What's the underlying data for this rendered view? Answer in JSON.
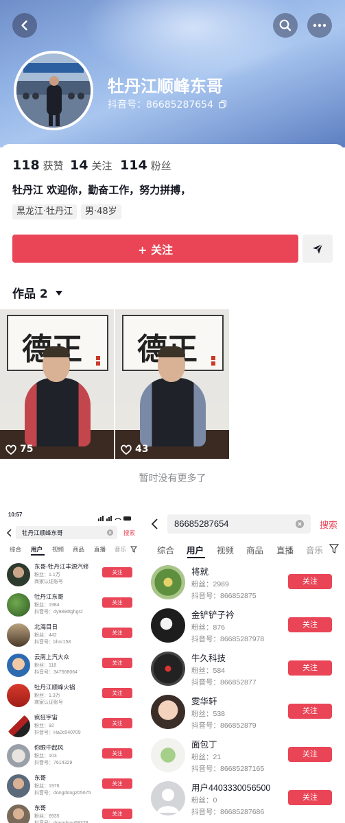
{
  "profile": {
    "name": "牡丹江顺峰东哥",
    "douyin_id": "抖音号：86685287654",
    "stats": [
      {
        "value": "118",
        "label": "获赞"
      },
      {
        "value": "14",
        "label": "关注"
      },
      {
        "value": "114",
        "label": "粉丝"
      }
    ],
    "bio": "牡丹江 欢迎你，勤奋工作，努力拼搏，",
    "tags": [
      "黑龙江·牡丹江",
      "男·48岁"
    ],
    "follow_label": "+ 关注",
    "works_label": "作品 2",
    "videos": [
      {
        "likes": "75",
        "calligraphy": "德正"
      },
      {
        "likes": "43",
        "calligraphy": "德正"
      }
    ],
    "no_more": "暂时没有更多了"
  },
  "left_search": {
    "status_time": "10:57",
    "query": "牡丹江顺峰东哥",
    "search_label": "搜索",
    "tabs": [
      "综合",
      "用户",
      "视频",
      "商品",
      "直播",
      "音乐"
    ],
    "active_tab": "用户",
    "follow_label": "关注",
    "results": [
      {
        "name": "东哥-牡丹江丰源汽修",
        "fans": "粉丝：1.1万",
        "sub": "商家认证账号"
      },
      {
        "name": "牡丹江东哥",
        "fans": "粉丝：1984",
        "sub": "抖音号：dy989dtghgr2"
      },
      {
        "name": "北海目日",
        "fans": "粉丝：442",
        "sub": "抖音号：bhxr158"
      },
      {
        "name": "云南上汽大众",
        "fans": "粉丝：118",
        "sub": "抖音号：347568064"
      },
      {
        "name": "牡丹江顺峰火锅",
        "fans": "粉丝：1.3万",
        "sub": "商家认证账号"
      },
      {
        "name": "疯狂宇宙",
        "fans": "粉丝：92",
        "sub": "抖音号：Ha0c040709"
      },
      {
        "name": "你眼中起风",
        "fans": "粉丝：103",
        "sub": "抖音号：7614329"
      },
      {
        "name": "东哥",
        "fans": "粉丝：1976",
        "sub": "抖音号：dongdong205675"
      },
      {
        "name": "东哥",
        "fans": "粉丝：6935",
        "sub": "抖音号：dongdong58378"
      }
    ]
  },
  "right_search": {
    "query": "86685287654",
    "search_label": "搜索",
    "tabs": [
      "综合",
      "用户",
      "视频",
      "商品",
      "直播",
      "音乐"
    ],
    "active_tab": "用户",
    "follow_label": "关注",
    "results": [
      {
        "name": "将就",
        "fans": "粉丝：2989",
        "id": "抖音号：866852875"
      },
      {
        "name": "金铲铲子衿",
        "fans": "粉丝：876",
        "id": "抖音号：86685287978"
      },
      {
        "name": "牛久科技",
        "fans": "粉丝：584",
        "id": "抖音号：866852877"
      },
      {
        "name": "雯华轩",
        "fans": "粉丝：538",
        "id": "抖音号：866852879"
      },
      {
        "name": "面包丁",
        "fans": "粉丝：21",
        "id": "抖音号：86685287165"
      },
      {
        "name": "用户4403330056500",
        "fans": "粉丝：0",
        "id": "抖音号：86685287686"
      }
    ]
  },
  "colors": {
    "accent": "#e94557",
    "header_blue": "#8fb0e4"
  },
  "icons": [
    "back-icon",
    "search-icon",
    "more-icon",
    "copy-icon",
    "share-icon",
    "heart-icon",
    "caret-down-icon",
    "clear-icon",
    "filter-icon"
  ]
}
